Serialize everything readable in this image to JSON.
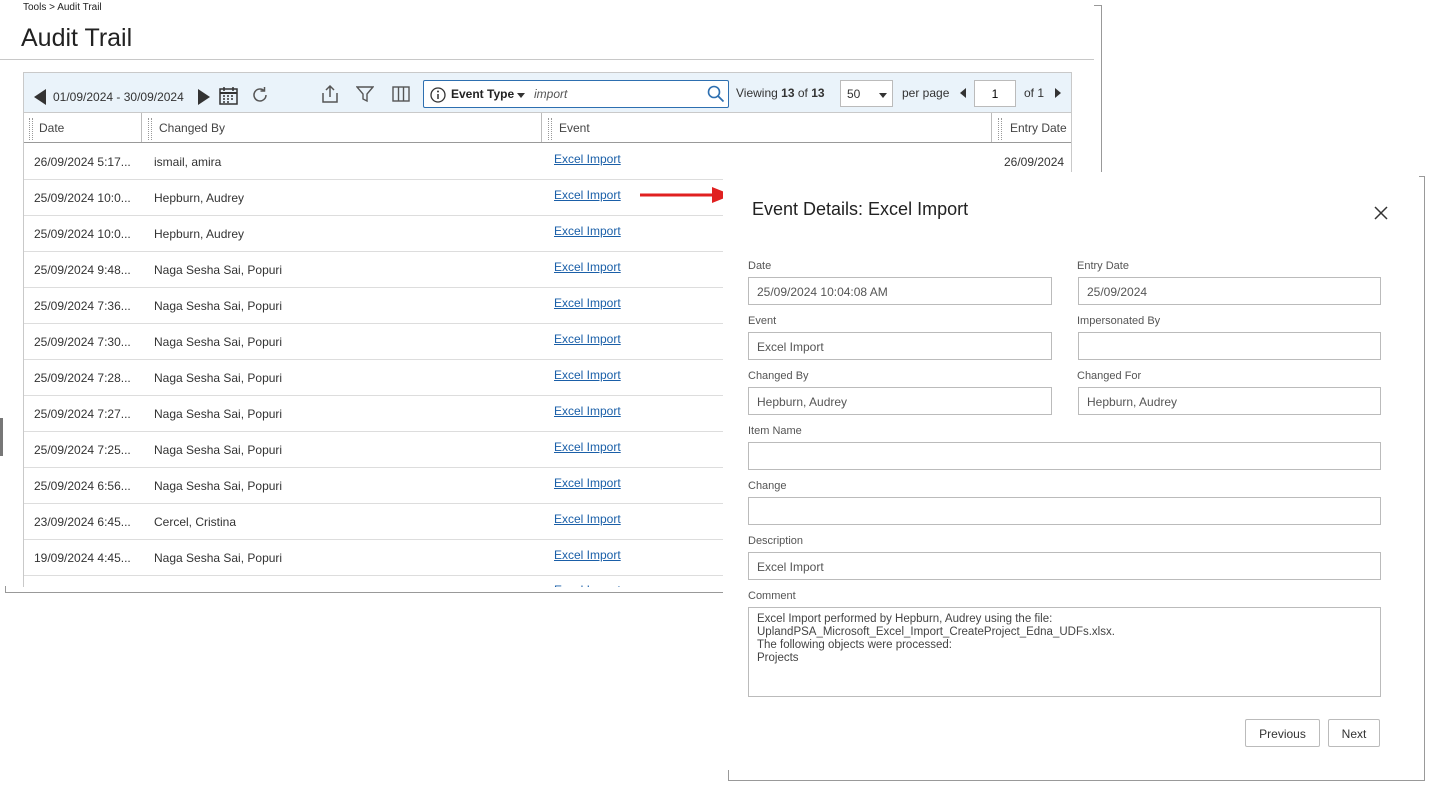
{
  "breadcrumb": "Tools > Audit Trail",
  "page_title": "Audit Trail",
  "toolbar": {
    "date_range": "01/09/2024 - 30/09/2024",
    "search": {
      "field_label": "Event Type",
      "value": "import"
    },
    "viewing_prefix": "Viewing",
    "viewing_count": "13",
    "viewing_of": "of",
    "viewing_total": "13",
    "per_page_value": "50",
    "per_page_label": "per page",
    "page_value": "1",
    "of_pages": "of 1"
  },
  "columns": [
    "Date",
    "Changed By",
    "Event",
    "Entry Date"
  ],
  "rows": [
    {
      "date": "26/09/2024 5:17...",
      "changed_by": "ismail, amira",
      "event": "Excel Import",
      "entry_date": "26/09/2024"
    },
    {
      "date": "25/09/2024 10:0...",
      "changed_by": "Hepburn, Audrey",
      "event": "Excel Import",
      "entry_date": ""
    },
    {
      "date": "25/09/2024 10:0...",
      "changed_by": "Hepburn, Audrey",
      "event": "Excel Import",
      "entry_date": ""
    },
    {
      "date": "25/09/2024 9:48...",
      "changed_by": "Naga Sesha Sai, Popuri",
      "event": "Excel Import",
      "entry_date": ""
    },
    {
      "date": "25/09/2024 7:36...",
      "changed_by": "Naga Sesha Sai, Popuri",
      "event": "Excel Import",
      "entry_date": ""
    },
    {
      "date": "25/09/2024 7:30...",
      "changed_by": "Naga Sesha Sai, Popuri",
      "event": "Excel Import",
      "entry_date": ""
    },
    {
      "date": "25/09/2024 7:28...",
      "changed_by": "Naga Sesha Sai, Popuri",
      "event": "Excel Import",
      "entry_date": ""
    },
    {
      "date": "25/09/2024 7:27...",
      "changed_by": "Naga Sesha Sai, Popuri",
      "event": "Excel Import",
      "entry_date": ""
    },
    {
      "date": "25/09/2024 7:25...",
      "changed_by": "Naga Sesha Sai, Popuri",
      "event": "Excel Import",
      "entry_date": ""
    },
    {
      "date": "25/09/2024 6:56...",
      "changed_by": "Naga Sesha Sai, Popuri",
      "event": "Excel Import",
      "entry_date": ""
    },
    {
      "date": "23/09/2024 6:45...",
      "changed_by": "Cercel, Cristina",
      "event": "Excel Import",
      "entry_date": ""
    },
    {
      "date": "19/09/2024 4:45...",
      "changed_by": "Naga Sesha Sai, Popuri",
      "event": "Excel Import",
      "entry_date": ""
    }
  ],
  "modal": {
    "title": "Event Details: Excel Import",
    "date_label": "Date",
    "date_value": "25/09/2024 10:04:08 AM",
    "entry_date_label": "Entry Date",
    "entry_date_value": "25/09/2024",
    "event_label": "Event",
    "event_value": "Excel Import",
    "impersonated_label": "Impersonated By",
    "impersonated_value": "",
    "changed_by_label": "Changed By",
    "changed_by_value": "Hepburn, Audrey",
    "changed_for_label": "Changed For",
    "changed_for_value": "Hepburn, Audrey",
    "item_name_label": "Item Name",
    "item_name_value": "",
    "change_label": "Change",
    "change_value": "",
    "description_label": "Description",
    "description_value": "Excel Import",
    "comment_label": "Comment",
    "comment_value": "Excel Import performed by Hepburn, Audrey using the file:\nUplandPSA_Microsoft_Excel_Import_CreateProject_Edna_UDFs.xlsx.\nThe following objects were processed:\nProjects",
    "previous_label": "Previous",
    "next_label": "Next"
  },
  "colors": {
    "accent": "#1a5fa8",
    "toolbar_bg": "#eaf3fa",
    "arrow": "#e02020"
  }
}
